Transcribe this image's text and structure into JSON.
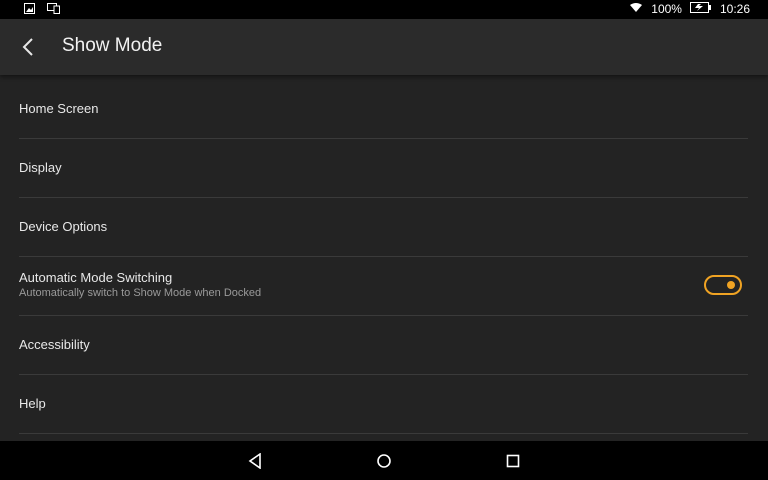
{
  "status_bar": {
    "battery_text": "100%",
    "time": "10:26",
    "icons": [
      "image-icon",
      "cast-icon",
      "wifi-icon",
      "battery-icon"
    ]
  },
  "app_bar": {
    "title": "Show Mode",
    "back_icon": "chevron-left-icon"
  },
  "settings": {
    "items": [
      {
        "label": "Home Screen"
      },
      {
        "label": "Display"
      },
      {
        "label": "Device Options"
      },
      {
        "label": "Automatic Mode Switching",
        "subtitle": "Automatically switch to Show Mode when Docked",
        "toggle": true
      },
      {
        "label": "Accessibility"
      },
      {
        "label": "Help"
      }
    ]
  },
  "nav_bar": {
    "icons": [
      "back-triangle-icon",
      "home-circle-icon",
      "recents-square-icon"
    ]
  },
  "colors": {
    "accent": "#f0a323",
    "background": "#232323",
    "app_bar": "#2b2b2b"
  }
}
